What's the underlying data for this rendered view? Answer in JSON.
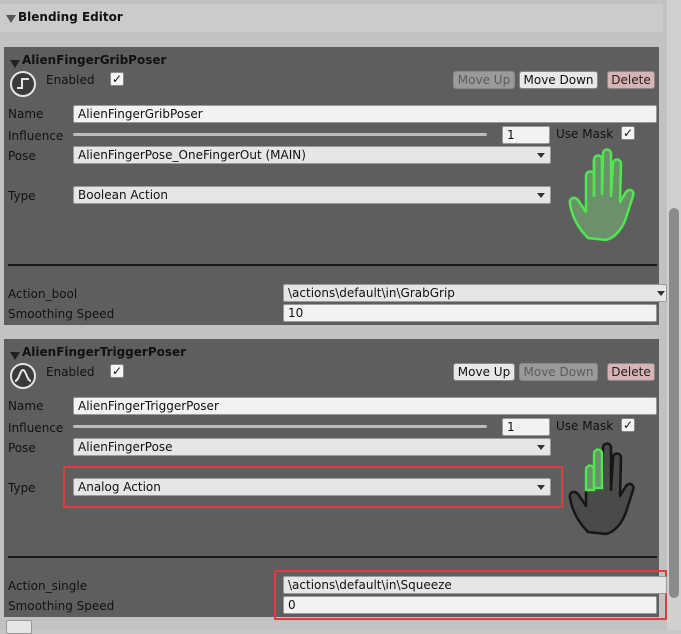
{
  "editor": {
    "title": "Blending Editor"
  },
  "posers": [
    {
      "title": "AlienFingerGribPoser",
      "enabled_label": "Enabled",
      "enabled_check": "✓",
      "buttons": {
        "move_up": "Move Up",
        "move_down": "Move Down",
        "delete": "Delete"
      },
      "name_label": "Name",
      "name_value": "AlienFingerGribPoser",
      "influence_label": "Influence",
      "influence_value": "1",
      "use_mask_label": "Use Mask",
      "use_mask_check": "✓",
      "pose_label": "Pose",
      "pose_value": "AlienFingerPose_OneFingerOut (MAIN)",
      "type_label": "Type",
      "type_value": "Boolean Action",
      "action_label": "Action_bool",
      "action_value": "\\actions\\default\\in\\GrabGrip",
      "smoothing_label": "Smoothing Speed",
      "smoothing_value": "10",
      "hand_color": "#4fe84f"
    },
    {
      "title": "AlienFingerTriggerPoser",
      "enabled_label": "Enabled",
      "enabled_check": "✓",
      "buttons": {
        "move_up": "Move Up",
        "move_down": "Move Down",
        "delete": "Delete"
      },
      "name_label": "Name",
      "name_value": "AlienFingerTriggerPoser",
      "influence_label": "Influence",
      "influence_value": "1",
      "use_mask_label": "Use Mask",
      "use_mask_check": "✓",
      "pose_label": "Pose",
      "pose_value": "AlienFingerPose",
      "type_label": "Type",
      "type_value": "Analog Action",
      "action_label": "Action_single",
      "action_value": "\\actions\\default\\in\\Squeeze",
      "smoothing_label": "Smoothing Speed",
      "smoothing_value": "0",
      "hand_color": "#1a1a1a",
      "finger_highlight": "#4fe84f"
    }
  ],
  "colors": {
    "highlight_box": "#e33b3b",
    "panel_bg": "#5e5e5e"
  }
}
